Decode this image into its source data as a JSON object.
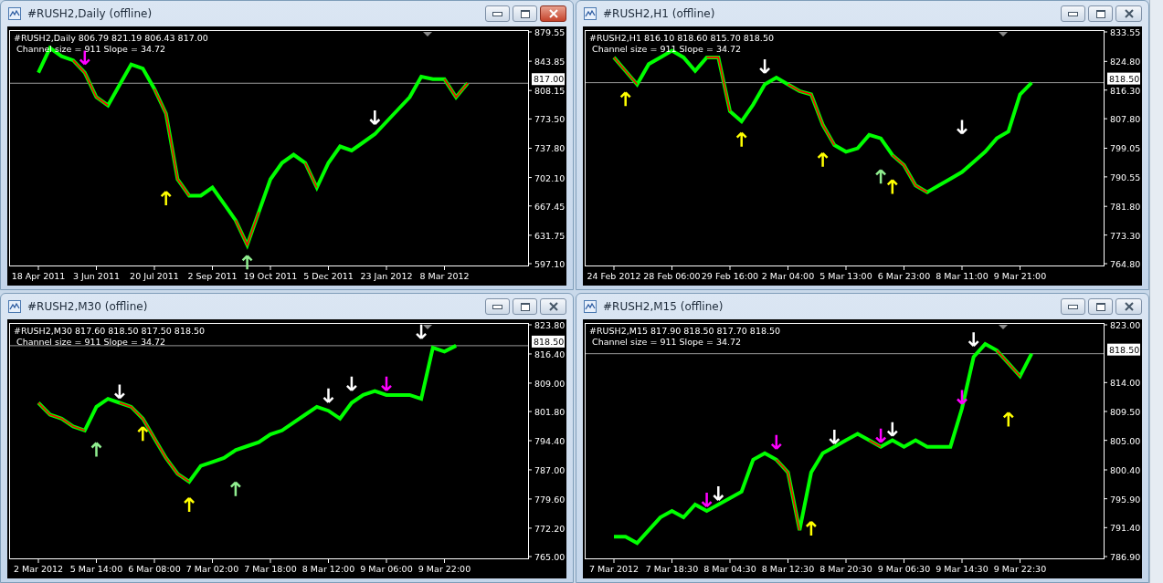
{
  "windows": [
    {
      "title": "#RUSH2,Daily (offline)",
      "active": true,
      "chart": {
        "header": "#RUSH2,Daily  806.79 821.19 806.43 817.00",
        "info": "Channel size = 911 Slope = 34.72",
        "chart_data": {
          "type": "line",
          "categories": [
            "18 Apr 2011",
            null,
            null,
            null,
            null,
            "3 Jun 2011",
            null,
            null,
            null,
            null,
            "20 Jul 2011",
            null,
            null,
            null,
            null,
            "2 Sep 2011",
            null,
            null,
            null,
            null,
            "19 Oct 2011",
            null,
            null,
            null,
            null,
            "5 Dec 2011",
            null,
            null,
            null,
            null,
            "23 Jan 2012",
            null,
            null,
            null,
            null,
            "8 Mar 2012",
            null,
            null
          ],
          "series": [
            {
              "color": "#00ff00",
              "values": [
                830,
                860,
                850,
                845,
                830,
                800,
                790,
                815,
                840,
                835,
                810,
                780,
                700,
                680,
                680,
                690,
                670,
                650,
                620,
                660,
                700,
                720,
                730,
                720,
                690,
                720,
                740,
                735,
                745,
                755,
                770,
                785,
                800,
                825,
                822,
                822,
                800,
                817
              ]
            },
            {
              "color": "#ff0000",
              "values": [
                null,
                null,
                null,
                845,
                830,
                800,
                790,
                null,
                null,
                null,
                810,
                780,
                700,
                680,
                null,
                null,
                null,
                650,
                620,
                660,
                null,
                null,
                null,
                720,
                690,
                null,
                null,
                null,
                null,
                null,
                null,
                null,
                null,
                null,
                null,
                822,
                800,
                817
              ]
            },
            {
              "type": "scatter",
              "color": "#ff00ff",
              "values": [
                null,
                null,
                null,
                null,
                848,
                null,
                null,
                null,
                null,
                null,
                null,
                null,
                null,
                null,
                null,
                null,
                null,
                null,
                null,
                null,
                null,
                null,
                null,
                null,
                null,
                null,
                null,
                null,
                null,
                null,
                null,
                null,
                null,
                null,
                null,
                null,
                null,
                null
              ]
            },
            {
              "type": "scatter",
              "color": "#ffff00",
              "values": [
                null,
                null,
                null,
                null,
                null,
                null,
                null,
                null,
                null,
                null,
                null,
                677,
                null,
                null,
                null,
                null,
                null,
                null,
                null,
                null,
                null,
                null,
                null,
                null,
                null,
                null,
                null,
                null,
                null,
                null,
                null,
                null,
                null,
                null,
                null,
                null,
                null,
                null
              ]
            },
            {
              "type": "scatter",
              "color": "#90ee90",
              "values": [
                null,
                null,
                null,
                null,
                null,
                null,
                null,
                null,
                null,
                null,
                null,
                null,
                null,
                null,
                null,
                null,
                null,
                null,
                599,
                null,
                null,
                null,
                null,
                null,
                null,
                null,
                null,
                null,
                null,
                null,
                null,
                null,
                null,
                null,
                null,
                null,
                null,
                null
              ]
            },
            {
              "type": "scatter",
              "color": "#ffffff",
              "values": [
                null,
                null,
                null,
                null,
                null,
                null,
                null,
                null,
                null,
                null,
                null,
                null,
                null,
                null,
                null,
                null,
                null,
                null,
                null,
                null,
                null,
                null,
                null,
                null,
                null,
                null,
                null,
                null,
                null,
                775,
                null,
                null,
                null,
                null,
                null,
                null,
                null,
                null
              ]
            }
          ],
          "ylim": [
            597.1,
            879.55
          ],
          "yticks": [
            {
              "value": 879.55,
              "label": "879.55"
            },
            {
              "value": 843.85,
              "label": "843.85"
            },
            {
              "value": 808.15,
              "label": "808.15"
            },
            {
              "value": 773.5,
              "label": "773.50"
            },
            {
              "value": 737.8,
              "label": "737.80"
            },
            {
              "value": 702.1,
              "label": "702.10"
            },
            {
              "value": 667.45,
              "label": "667.45"
            },
            {
              "value": 631.75,
              "label": "631.75"
            },
            {
              "value": 597.1,
              "label": "597.10"
            }
          ],
          "ref_lines": [
            {
              "axis": "y",
              "value": 817,
              "label": "817.00"
            }
          ]
        }
      }
    },
    {
      "title": "#RUSH2,H1 (offline)",
      "active": false,
      "chart": {
        "header": "#RUSH2,H1  816.10 818.60 815.70 818.50",
        "info": "Channel size = 911 Slope = 34.72",
        "chart_data": {
          "type": "line",
          "categories": [
            "24 Feb 2012",
            null,
            null,
            null,
            null,
            "28 Feb 06:00",
            null,
            null,
            null,
            null,
            "29 Feb 16:00",
            null,
            null,
            null,
            null,
            "2 Mar 04:00",
            null,
            null,
            null,
            null,
            "5 Mar 13:00",
            null,
            null,
            null,
            null,
            "6 Mar 23:00",
            null,
            null,
            null,
            null,
            "8 Mar 11:00",
            null,
            null,
            null,
            null,
            "9 Mar 21:00",
            null
          ],
          "series": [
            {
              "color": "#00ff00",
              "values": [
                826,
                822,
                818,
                824,
                826,
                828,
                826,
                822,
                826,
                826,
                810,
                807,
                812,
                818,
                820,
                818,
                816,
                815,
                806,
                800,
                798,
                799,
                803,
                802,
                797,
                794,
                788,
                786,
                788,
                790,
                792,
                795,
                798,
                802,
                804,
                815,
                818.5
              ]
            },
            {
              "color": "#ff0000",
              "values": [
                826,
                822,
                818,
                null,
                null,
                null,
                null,
                null,
                826,
                826,
                810,
                null,
                null,
                null,
                null,
                818,
                816,
                815,
                806,
                800,
                null,
                null,
                null,
                null,
                797,
                794,
                788,
                786,
                null,
                null,
                null,
                null,
                null,
                null,
                null,
                null,
                null
              ]
            },
            {
              "type": "scatter",
              "color": "#ffff00",
              "values": [
                null,
                813.7,
                null,
                null,
                null,
                null,
                null,
                null,
                null,
                null,
                null,
                801.7,
                null,
                null,
                null,
                null,
                null,
                null,
                795.7,
                null,
                null,
                null,
                null,
                null,
                787.7,
                null,
                null,
                null,
                null,
                null,
                null,
                null,
                null,
                null,
                null,
                null,
                null
              ]
            },
            {
              "type": "scatter",
              "color": "#90ee90",
              "values": [
                null,
                null,
                null,
                null,
                null,
                null,
                null,
                null,
                null,
                null,
                null,
                null,
                null,
                null,
                null,
                null,
                null,
                null,
                null,
                null,
                null,
                null,
                null,
                790.7,
                null,
                null,
                null,
                null,
                null,
                null,
                null,
                null,
                null,
                null,
                null,
                null,
                null
              ]
            },
            {
              "type": "scatter",
              "color": "#ffffff",
              "values": [
                null,
                null,
                null,
                null,
                null,
                null,
                null,
                null,
                null,
                null,
                null,
                null,
                null,
                823.3,
                null,
                null,
                null,
                null,
                null,
                null,
                null,
                null,
                null,
                null,
                null,
                null,
                null,
                null,
                null,
                null,
                805.3,
                null,
                null,
                null,
                null,
                null,
                null
              ]
            }
          ],
          "ylim": [
            764.8,
            833.55
          ],
          "yticks": [
            {
              "value": 833.55,
              "label": "833.55"
            },
            {
              "value": 824.8,
              "label": "824.80"
            },
            {
              "value": 816.3,
              "label": "816.30"
            },
            {
              "value": 807.8,
              "label": "807.80"
            },
            {
              "value": 799.05,
              "label": "799.05"
            },
            {
              "value": 790.55,
              "label": "790.55"
            },
            {
              "value": 781.8,
              "label": "781.80"
            },
            {
              "value": 773.3,
              "label": "773.30"
            },
            {
              "value": 764.8,
              "label": "764.80"
            }
          ],
          "ref_lines": [
            {
              "axis": "y",
              "value": 818.5,
              "label": "818.50"
            }
          ]
        }
      }
    },
    {
      "title": "#RUSH2,M30 (offline)",
      "active": false,
      "chart": {
        "header": "#RUSH2,M30  817.60 818.50 817.50 818.50",
        "info": "Channel size = 911 Slope = 34.72",
        "chart_data": {
          "type": "line",
          "categories": [
            "2 Mar 2012",
            null,
            null,
            null,
            null,
            "5 Mar 14:00",
            null,
            null,
            null,
            null,
            "6 Mar 08:00",
            null,
            null,
            null,
            null,
            "7 Mar 02:00",
            null,
            null,
            null,
            null,
            "7 Mar 18:00",
            null,
            null,
            null,
            null,
            "8 Mar 12:00",
            null,
            null,
            null,
            null,
            "9 Mar 06:00",
            null,
            null,
            null,
            null,
            "9 Mar 22:00",
            null
          ],
          "series": [
            {
              "color": "#00ff00",
              "values": [
                804,
                801,
                800,
                798,
                797,
                803,
                805,
                804,
                803,
                800,
                795,
                790,
                786,
                784,
                788,
                789,
                790,
                792,
                793,
                794,
                796,
                797,
                799,
                801,
                803,
                802,
                800,
                804,
                806,
                807,
                806,
                806,
                806,
                805,
                818,
                817,
                818.5
              ]
            },
            {
              "color": "#ff0000",
              "values": [
                804,
                801,
                800,
                798,
                797,
                null,
                null,
                804,
                803,
                800,
                795,
                790,
                786,
                784,
                null,
                null,
                null,
                null,
                null,
                null,
                null,
                null,
                null,
                null,
                null,
                null,
                null,
                null,
                null,
                null,
                null,
                null,
                null,
                null,
                null,
                null,
                null
              ]
            },
            {
              "type": "scatter",
              "color": "#ffff00",
              "values": [
                null,
                null,
                null,
                null,
                null,
                null,
                null,
                null,
                null,
                796.2,
                null,
                null,
                null,
                778.2,
                null,
                null,
                null,
                null,
                null,
                null,
                null,
                null,
                null,
                null,
                null,
                null,
                null,
                null,
                null,
                null,
                null,
                null,
                null,
                null,
                null,
                null,
                null
              ]
            },
            {
              "type": "scatter",
              "color": "#90ee90",
              "values": [
                null,
                null,
                null,
                null,
                null,
                792.2,
                null,
                null,
                null,
                null,
                null,
                null,
                null,
                null,
                null,
                null,
                null,
                782.2,
                null,
                null,
                null,
                null,
                null,
                null,
                null,
                null,
                null,
                null,
                null,
                null,
                null,
                null,
                null,
                null,
                null,
                null,
                null
              ]
            },
            {
              "type": "scatter",
              "color": "#ffffff",
              "values": [
                null,
                null,
                null,
                null,
                null,
                null,
                null,
                806.8,
                null,
                null,
                null,
                null,
                null,
                null,
                null,
                null,
                null,
                null,
                null,
                null,
                null,
                null,
                null,
                null,
                null,
                805.8,
                null,
                808.8,
                null,
                null,
                null,
                null,
                null,
                822,
                null,
                null,
                null
              ]
            },
            {
              "type": "scatter",
              "color": "#ff00ff",
              "values": [
                null,
                null,
                null,
                null,
                null,
                null,
                null,
                null,
                null,
                null,
                null,
                null,
                null,
                null,
                null,
                null,
                null,
                null,
                null,
                null,
                null,
                null,
                null,
                null,
                null,
                null,
                null,
                null,
                null,
                null,
                808.8,
                null,
                null,
                null,
                null,
                null,
                null
              ]
            }
          ],
          "ylim": [
            765,
            823.8
          ],
          "yticks": [
            {
              "value": 823.8,
              "label": "823.80"
            },
            {
              "value": 816.4,
              "label": "816.40"
            },
            {
              "value": 809,
              "label": "809.00"
            },
            {
              "value": 801.8,
              "label": "801.80"
            },
            {
              "value": 794.4,
              "label": "794.40"
            },
            {
              "value": 787,
              "label": "787.00"
            },
            {
              "value": 779.6,
              "label": "779.60"
            },
            {
              "value": 772.2,
              "label": "772.20"
            },
            {
              "value": 765,
              "label": "765.00"
            }
          ],
          "ref_lines": [
            {
              "axis": "y",
              "value": 818.5,
              "label": "818.50"
            }
          ]
        }
      }
    },
    {
      "title": "#RUSH2,M15 (offline)",
      "active": false,
      "chart": {
        "header": "#RUSH2,M15  817.90 818.50 817.70 818.50",
        "info": "Channel size = 911 Slope = 34.72",
        "chart_data": {
          "type": "line",
          "categories": [
            "7 Mar 2012",
            null,
            null,
            null,
            null,
            "7 Mar 18:30",
            null,
            null,
            null,
            null,
            "8 Mar 04:30",
            null,
            null,
            null,
            null,
            "8 Mar 12:30",
            null,
            null,
            null,
            null,
            "8 Mar 20:30",
            null,
            null,
            null,
            null,
            "9 Mar 06:30",
            null,
            null,
            null,
            null,
            "9 Mar 14:30",
            null,
            null,
            null,
            null,
            "9 Mar 22:30",
            null
          ],
          "series": [
            {
              "color": "#00ff00",
              "values": [
                790,
                790,
                789,
                791,
                793,
                794,
                793,
                795,
                794,
                795,
                796,
                797,
                802,
                803,
                802,
                800,
                791,
                800,
                803,
                804,
                805,
                806,
                805,
                804,
                805,
                804,
                805,
                804,
                804,
                804,
                810,
                818,
                820,
                819,
                817,
                815,
                818.5
              ]
            },
            {
              "color": "#ff0000",
              "values": [
                null,
                null,
                null,
                null,
                null,
                null,
                null,
                null,
                null,
                null,
                null,
                null,
                null,
                null,
                802,
                800,
                791,
                null,
                null,
                null,
                null,
                null,
                805,
                804,
                null,
                null,
                null,
                null,
                null,
                null,
                null,
                null,
                null,
                819,
                817,
                815,
                null
              ]
            },
            {
              "type": "scatter",
              "color": "#ff00ff",
              "values": [
                null,
                null,
                null,
                null,
                null,
                null,
                null,
                null,
                795.7,
                null,
                null,
                null,
                null,
                null,
                804.7,
                null,
                null,
                null,
                null,
                null,
                null,
                null,
                null,
                805.7,
                null,
                null,
                null,
                null,
                null,
                null,
                811.7,
                null,
                null,
                null,
                null,
                null,
                null
              ]
            },
            {
              "type": "scatter",
              "color": "#ffffff",
              "values": [
                null,
                null,
                null,
                null,
                null,
                null,
                null,
                null,
                null,
                796.7,
                null,
                null,
                null,
                null,
                null,
                null,
                null,
                null,
                null,
                805.5,
                null,
                null,
                null,
                null,
                806.7,
                null,
                null,
                null,
                null,
                null,
                null,
                820.7,
                null,
                null,
                null,
                null,
                null
              ]
            },
            {
              "type": "scatter",
              "color": "#ffff00",
              "values": [
                null,
                null,
                null,
                null,
                null,
                null,
                null,
                null,
                null,
                null,
                null,
                null,
                null,
                null,
                null,
                null,
                null,
                791.3,
                null,
                null,
                null,
                null,
                null,
                null,
                null,
                null,
                null,
                null,
                null,
                null,
                null,
                null,
                null,
                null,
                808.3,
                null,
                null
              ]
            }
          ],
          "ylim": [
            786.9,
            823
          ],
          "yticks": [
            {
              "value": 823,
              "label": "823.00"
            },
            {
              "value": 814,
              "label": "814.00"
            },
            {
              "value": 809.5,
              "label": "809.50"
            },
            {
              "value": 805,
              "label": "805.00"
            },
            {
              "value": 800.4,
              "label": "800.40"
            },
            {
              "value": 795.9,
              "label": "795.90"
            },
            {
              "value": 791.4,
              "label": "791.40"
            },
            {
              "value": 786.9,
              "label": "786.90"
            }
          ],
          "ref_lines": [
            {
              "axis": "y",
              "value": 818.5,
              "label": "818.50"
            }
          ]
        }
      }
    }
  ]
}
